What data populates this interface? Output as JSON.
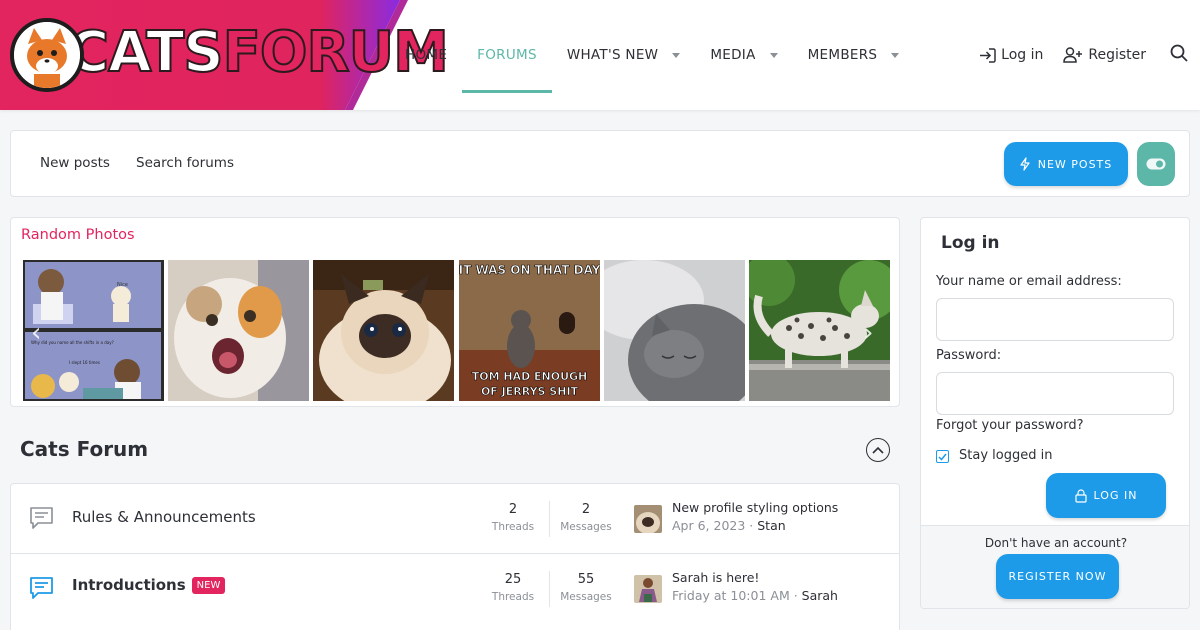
{
  "brand": {
    "logo_word_1": "CATS",
    "logo_word_2": "FORUM",
    "primary_color": "#e2245f",
    "accent_color": "#5cb7a8",
    "button_color": "#1e9be8"
  },
  "nav": {
    "items": [
      {
        "label": "HOME"
      },
      {
        "label": "FORUMS",
        "active": true
      },
      {
        "label": "WHAT'S NEW",
        "has_menu": true
      },
      {
        "label": "MEDIA",
        "has_menu": true
      },
      {
        "label": "MEMBERS",
        "has_menu": true
      }
    ],
    "login_label": "Log in",
    "register_label": "Register"
  },
  "subnav": {
    "new_posts_link": "New posts",
    "search_link": "Search forums",
    "new_posts_button": "NEW POSTS"
  },
  "photos": {
    "title": "Random Photos",
    "items": [
      {
        "caption_top": "Nice",
        "caption_mid": "Why did you name all the shifts in a day?",
        "caption_bot": "I slept 16 times"
      },
      {
        "caption_top": ""
      },
      {
        "caption_top": ""
      },
      {
        "caption_top": "IT WAS ON THAT DAY",
        "caption_bot_1": "TOM HAD ENOUGH",
        "caption_bot_2": "OF JERRYS SHIT"
      },
      {
        "caption_top": ""
      },
      {
        "caption_top": ""
      }
    ]
  },
  "section": {
    "title": "Cats Forum",
    "forums": [
      {
        "name": "Rules & Announcements",
        "threads": "2",
        "threads_label": "Threads",
        "messages": "2",
        "messages_label": "Messages",
        "last_title": "New profile styling options",
        "last_date": "Apr 6, 2023",
        "last_user": "Stan",
        "is_new": false
      },
      {
        "name": "Introductions",
        "badge": "NEW",
        "threads": "25",
        "threads_label": "Threads",
        "messages": "55",
        "messages_label": "Messages",
        "last_title": "Sarah is here!",
        "last_date": "Friday at 10:01 AM",
        "last_user": "Sarah",
        "is_new": true
      }
    ]
  },
  "login": {
    "title": "Log in",
    "name_label": "Your name or email address:",
    "name_value": "",
    "password_label": "Password:",
    "password_value": "",
    "forgot": "Forgot your password?",
    "stay_logged_in": "Stay logged in",
    "stay_checked": true,
    "login_button": "LOG IN",
    "no_account": "Don't have an account?",
    "register_button": "REGISTER NOW"
  }
}
